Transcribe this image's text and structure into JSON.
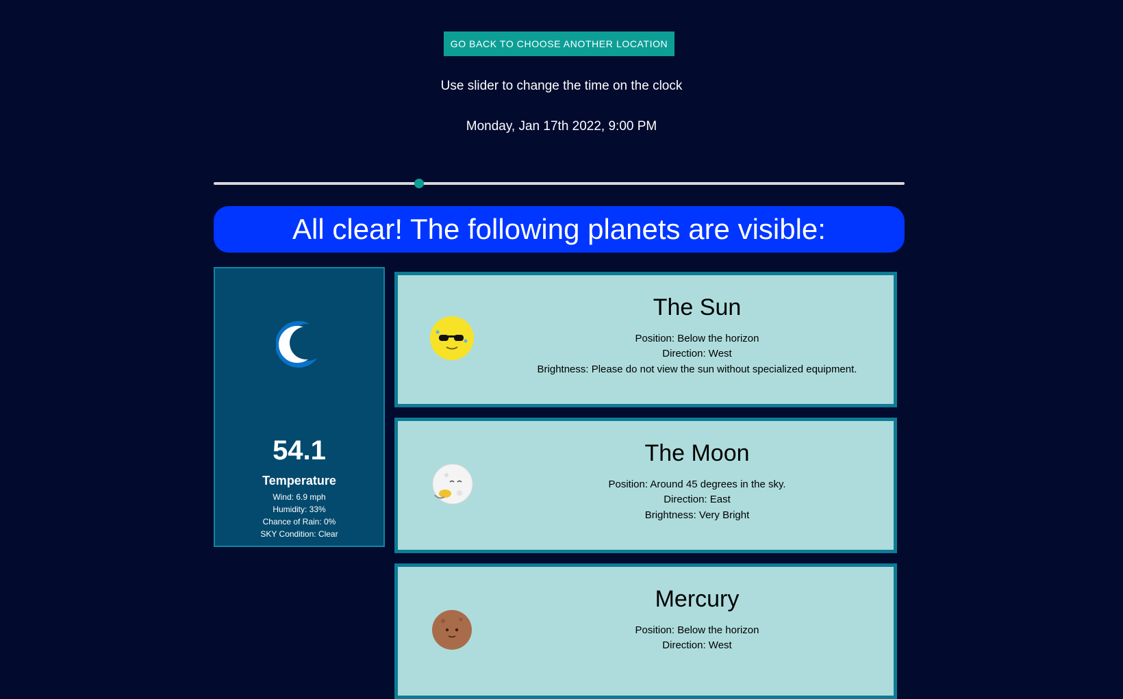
{
  "header": {
    "back_button_label": "GO BACK TO CHOOSE ANOTHER LOCATION",
    "hint": "Use slider to change the time on the clock",
    "datetime": "Monday, Jan 17th 2022, 9:00 PM"
  },
  "slider": {
    "value_fraction": 0.297
  },
  "banner": {
    "text": "All clear! The following planets are visible:"
  },
  "weather": {
    "icon": "crescent-moon-icon",
    "temperature": "54.1",
    "temperature_label": "Temperature",
    "wind": "Wind: 6.9 mph",
    "humidity": "Humidity: 33%",
    "rain": "Chance of Rain: 0%",
    "sky": "SKY Condition: Clear"
  },
  "planets": [
    {
      "name": "The Sun",
      "icon": "sun-sunglasses-icon",
      "position": "Position: Below the horizon",
      "direction": "Direction: West",
      "brightness": "Brightness: Please do not view the sun without specialized equipment."
    },
    {
      "name": "The Moon",
      "icon": "moon-face-icon",
      "position": "Position: Around 45 degrees in the sky.",
      "direction": "Direction: East",
      "brightness": "Brightness: Very Bright"
    },
    {
      "name": "Mercury",
      "icon": "mercury-face-icon",
      "position": "Position: Below the horizon",
      "direction": "Direction: West",
      "brightness": ""
    }
  ],
  "colors": {
    "background": "#020a2e",
    "accent_teal": "#0d9f96",
    "banner_blue": "#0036ff",
    "weather_card": "#034a6e",
    "planet_card": "#aedcdc",
    "planet_border": "#0d7c95"
  }
}
